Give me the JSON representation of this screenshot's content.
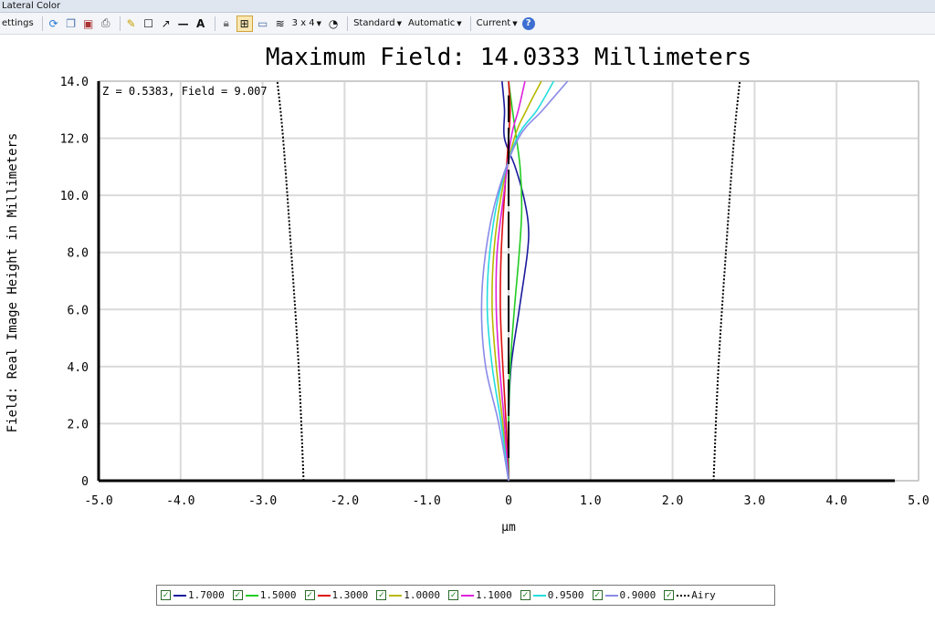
{
  "window": {
    "title": "Lateral Color"
  },
  "toolbar": {
    "settings_label": "ettings",
    "layout_label": "3 x 4",
    "standard_label": "Standard",
    "automatic_label": "Automatic",
    "current_label": "Current",
    "icons": [
      "refresh-icon",
      "copy-icon",
      "save-icon",
      "print-icon",
      "pencil-icon",
      "rectangle-icon",
      "arrow-icon",
      "line-icon",
      "text-icon",
      "lock-icon",
      "zoom-fit-icon",
      "window-icon",
      "layers-icon",
      "clock-icon",
      "help-icon"
    ]
  },
  "chart_data": {
    "type": "line",
    "title": "Maximum Field: 14.0333 Millimeters",
    "annotation": "Z = 0.5383, Field = 9.007",
    "xlabel": "µm",
    "ylabel": "Field: Real Image Height in Millimeters",
    "xlim": [
      -5.0,
      5.0
    ],
    "ylim": [
      0,
      14.0
    ],
    "xticks": [
      "-5.0",
      "-4.0",
      "-3.0",
      "-2.0",
      "-1.0",
      "0",
      "1.0",
      "2.0",
      "3.0",
      "4.0",
      "5.0"
    ],
    "yticks": [
      "0",
      "2.0",
      "4.0",
      "6.0",
      "8.0",
      "10.0",
      "12.0",
      "14.0"
    ],
    "grid": true,
    "legend_position": "bottom",
    "series": [
      {
        "name": "1.7000",
        "color": "#1a1a9c",
        "dash": "solid",
        "points": [
          [
            0,
            0
          ],
          [
            0.0,
            2
          ],
          [
            0.03,
            4
          ],
          [
            0.13,
            6
          ],
          [
            0.23,
            8
          ],
          [
            0.24,
            9
          ],
          [
            0.18,
            10
          ],
          [
            0.08,
            11
          ],
          [
            -0.05,
            12
          ],
          [
            -0.05,
            13
          ],
          [
            -0.08,
            14
          ]
        ]
      },
      {
        "name": "1.5000",
        "color": "#22cc22",
        "dash": "solid",
        "points": [
          [
            0,
            0
          ],
          [
            0.0,
            2
          ],
          [
            0.02,
            4
          ],
          [
            0.07,
            6
          ],
          [
            0.13,
            8
          ],
          [
            0.16,
            9.5
          ],
          [
            0.14,
            11
          ],
          [
            0.07,
            12.5
          ],
          [
            0.0,
            14
          ]
        ]
      },
      {
        "name": "1.3000",
        "color": "#dd1111",
        "dash": "solid",
        "points": [
          [
            0,
            0
          ],
          [
            -0.03,
            2
          ],
          [
            -0.07,
            4
          ],
          [
            -0.1,
            6
          ],
          [
            -0.09,
            8
          ],
          [
            -0.05,
            10
          ],
          [
            0.0,
            12
          ],
          [
            0.02,
            13
          ],
          [
            0.0,
            14
          ]
        ]
      },
      {
        "name": "1.0000",
        "color": "#b8b800",
        "dash": "solid",
        "points": [
          [
            0,
            0
          ],
          [
            -0.07,
            2
          ],
          [
            -0.15,
            4
          ],
          [
            -0.2,
            6
          ],
          [
            -0.18,
            8
          ],
          [
            -0.09,
            10
          ],
          [
            0.07,
            12
          ],
          [
            0.22,
            13
          ],
          [
            0.4,
            14
          ]
        ]
      },
      {
        "name": "1.1000",
        "color": "#dd22dd",
        "dash": "solid",
        "points": [
          [
            0,
            0
          ],
          [
            -0.05,
            2
          ],
          [
            -0.11,
            4
          ],
          [
            -0.15,
            6
          ],
          [
            -0.14,
            8
          ],
          [
            -0.06,
            10
          ],
          [
            0.03,
            12
          ],
          [
            0.12,
            13
          ],
          [
            0.2,
            14
          ]
        ]
      },
      {
        "name": "0.9500",
        "color": "#22dddd",
        "dash": "solid",
        "points": [
          [
            0,
            0
          ],
          [
            -0.09,
            2
          ],
          [
            -0.2,
            4
          ],
          [
            -0.26,
            6
          ],
          [
            -0.23,
            8
          ],
          [
            -0.12,
            10
          ],
          [
            0.1,
            12
          ],
          [
            0.35,
            13
          ],
          [
            0.55,
            14
          ]
        ]
      },
      {
        "name": "0.9000",
        "color": "#8a8ae8",
        "dash": "solid",
        "points": [
          [
            0,
            0
          ],
          [
            -0.12,
            2
          ],
          [
            -0.28,
            4
          ],
          [
            -0.33,
            6
          ],
          [
            -0.28,
            8
          ],
          [
            -0.14,
            10
          ],
          [
            0.12,
            12
          ],
          [
            0.42,
            13
          ],
          [
            0.72,
            14
          ]
        ]
      },
      {
        "name": "Airy",
        "color": "#000000",
        "dash": "dotted",
        "points": [
          [
            -2.5,
            0
          ],
          [
            -2.56,
            4
          ],
          [
            -2.65,
            8
          ],
          [
            -2.75,
            12
          ],
          [
            -2.82,
            14
          ]
        ]
      },
      {
        "name": "",
        "color": "#000000",
        "dash": "dotted",
        "legend": false,
        "points": [
          [
            2.5,
            0
          ],
          [
            2.56,
            4
          ],
          [
            2.65,
            8
          ],
          [
            2.75,
            12
          ],
          [
            2.82,
            14
          ]
        ]
      }
    ]
  }
}
